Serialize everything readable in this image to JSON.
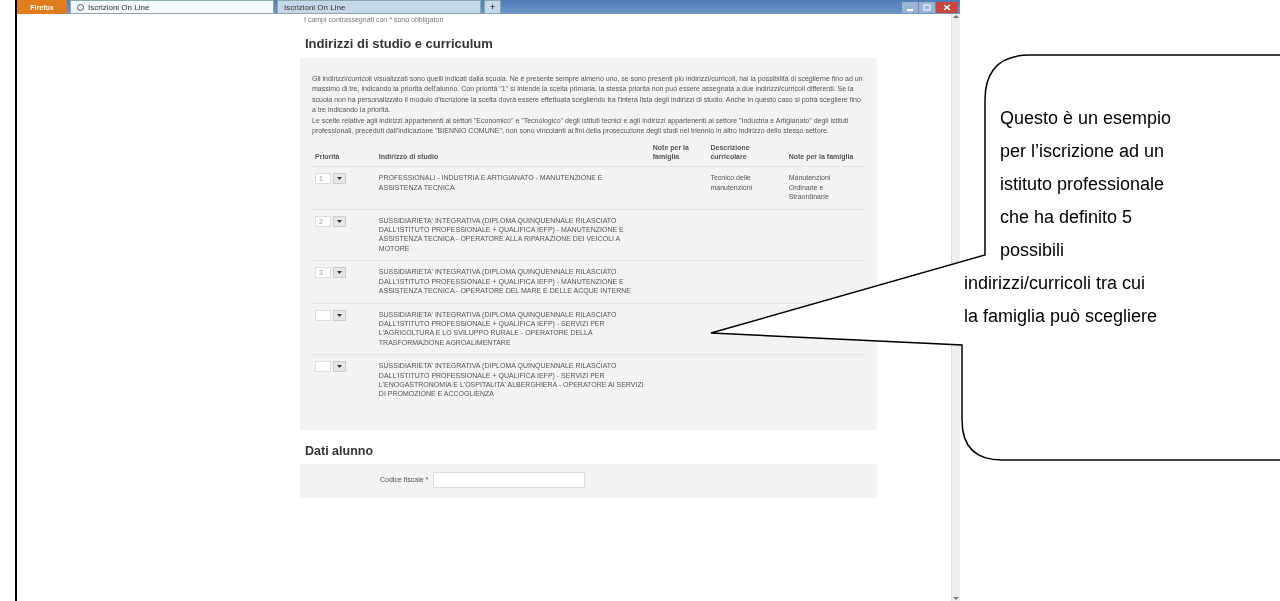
{
  "browser": {
    "menu_button": "Firefox",
    "tabs": [
      {
        "title": "Iscrizioni On Line",
        "selected": true
      },
      {
        "title": "Iscrizioni On Line",
        "selected": false
      }
    ],
    "new_tab": "+"
  },
  "page": {
    "top_note": "I campi contrassegnati con * sono obbligatori",
    "section_title": "Indirizzi di studio e curriculum",
    "intro": [
      "Gli indirizzi/curricoli visualizzati sono quelli indicati dalla scuola. Ne è presente sempre almeno uno, se sono presenti più indirizzi/curricoli, hai la possibilità di sceglierne fino ad un massimo di tre, indicando la priorità dell'alunno. Con priorità \"1\" si intende la scelta primaria, la stessa priorità non può essere assegnata a due indirizzi/curricoli differenti. Se la scuola non ha personalizzato il modulo d'iscrizione la scelta dovrà essere effettuata scegliendo tra l'intera lista degli indirizzi di studio. Anche in questo caso si potrà scegliere fino a tre indicando la priorità.",
      "Le scelte relative agli indirizzi appartenenti ai settori \"Economico\" e \"Tecnologico\" degli istituti tecnici e agli indirizzi appartenenti al settore \"Industria e Artigianato\" degli istituti professionali, preceduti dall'indicazione \"BIENNIO COMUNE\", non sono vincolanti ai fini della prosecuzione degli studi nel triennio in altro indirizzo dello stesso settore."
    ],
    "table": {
      "columns": [
        "Priorità",
        "Indirizzo di studio",
        "Note per la famiglia",
        "Descrizione curricolare",
        "Note per la famiglia"
      ],
      "rows": [
        {
          "priority": "1",
          "indirizzo": "PROFESSIONALI - INDUSTRIA E ARTIGIANATO - MANUTENZIONE E ASSISTENZA TECNICA",
          "descrizione": "Tecnico delle manutenzioni",
          "note_famiglia": "Manutenzioni Ordinarie e Straordinarie"
        },
        {
          "priority": "2",
          "indirizzo": "SUSSIDIARIETA' INTEGRATIVA (DIPLOMA QUINQUENNALE RILASCIATO DALL'ISTITUTO PROFESSIONALE + QUALIFICA IEFP) - MANUTENZIONE E ASSISTENZA TECNICA - OPERATORE ALLA RIPARAZIONE DEI VEICOLI A MOTORE"
        },
        {
          "priority": "3",
          "indirizzo": "SUSSIDIARIETA' INTEGRATIVA (DIPLOMA QUINQUENNALE RILASCIATO DALL'ISTITUTO PROFESSIONALE + QUALIFICA IEFP) - MANUTENZIONE E ASSISTENZA TECNICA - OPERATORE DEL MARE E DELLE ACQUE INTERNE"
        },
        {
          "indirizzo": "SUSSIDIARIETA' INTEGRATIVA (DIPLOMA QUINQUENNALE RILASCIATO DALL'ISTITUTO PROFESSIONALE + QUALIFICA IEFP) - SERVIZI PER L'AGRICOLTURA E LO SVILUPPO RURALE - OPERATORE DELLA TRASFORMAZIONE AGROALIMENTARE"
        },
        {
          "indirizzo": "SUSSIDIARIETA' INTEGRATIVA (DIPLOMA QUINQUENNALE RILASCIATO DALL'ISTITUTO PROFESSIONALE + QUALIFICA IEFP) - SERVIZI PER L'ENOGASTRONOMIA E L'OSPITALITA' ALBERGHIERA - OPERATORE AI SERVIZI DI PROMOZIONE E ACCOGLIENZA"
        }
      ]
    },
    "section2_title": "Dati alunno",
    "field_label": "Codice fiscale *"
  },
  "callout": {
    "lines": [
      "Questo è un esempio",
      "per l’iscrizione ad un",
      "istituto professionale",
      "che ha definito 5",
      "possibili",
      "indirizzi/curricoli tra cui",
      "la famiglia può scegliere"
    ]
  }
}
